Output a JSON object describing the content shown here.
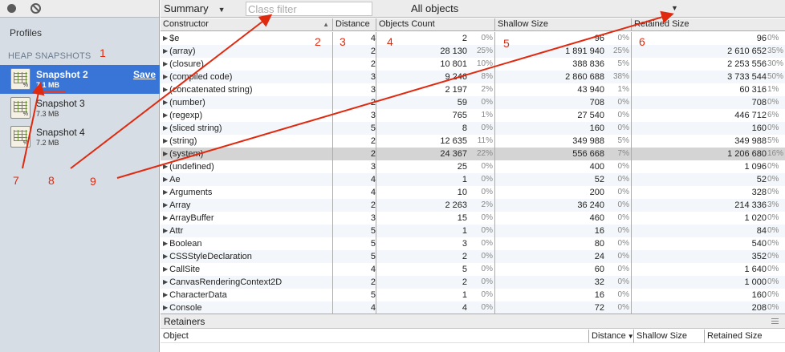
{
  "sidebar": {
    "profiles_title": "Profiles",
    "heap_header": "HEAP SNAPSHOTS",
    "snapshots": [
      {
        "name": "Snapshot 2",
        "size": "7.1 MB",
        "selected": true
      },
      {
        "name": "Snapshot 3",
        "size": "7.3 MB",
        "selected": false
      },
      {
        "name": "Snapshot 4",
        "size": "7.2 MB",
        "selected": false
      }
    ],
    "save_label": "Save"
  },
  "toolbar": {
    "view_select": "Summary",
    "class_filter_placeholder": "Class filter",
    "objects_select": "All objects"
  },
  "columns": {
    "constructor": "Constructor",
    "distance": "Distance",
    "objects_count": "Objects Count",
    "shallow_size": "Shallow Size",
    "retained_size": "Retained Size"
  },
  "rows": [
    {
      "name": "$e",
      "distance": "4",
      "count": "2",
      "count_pct": "0%",
      "shallow": "96",
      "shallow_pct": "0%",
      "retained": "96",
      "retained_pct": "0%"
    },
    {
      "name": "(array)",
      "distance": "2",
      "count": "28 130",
      "count_pct": "25%",
      "shallow": "1 891 940",
      "shallow_pct": "25%",
      "retained": "2 610 652",
      "retained_pct": "35%"
    },
    {
      "name": "(closure)",
      "distance": "2",
      "count": "10 801",
      "count_pct": "10%",
      "shallow": "388 836",
      "shallow_pct": "5%",
      "retained": "2 253 556",
      "retained_pct": "30%"
    },
    {
      "name": "(compiled code)",
      "distance": "3",
      "count": "9 246",
      "count_pct": "8%",
      "shallow": "2 860 688",
      "shallow_pct": "38%",
      "retained": "3 733 544",
      "retained_pct": "50%"
    },
    {
      "name": "(concatenated string)",
      "distance": "3",
      "count": "2 197",
      "count_pct": "2%",
      "shallow": "43 940",
      "shallow_pct": "1%",
      "retained": "60 316",
      "retained_pct": "1%"
    },
    {
      "name": "(number)",
      "distance": "2",
      "count": "59",
      "count_pct": "0%",
      "shallow": "708",
      "shallow_pct": "0%",
      "retained": "708",
      "retained_pct": "0%"
    },
    {
      "name": "(regexp)",
      "distance": "3",
      "count": "765",
      "count_pct": "1%",
      "shallow": "27 540",
      "shallow_pct": "0%",
      "retained": "446 712",
      "retained_pct": "6%"
    },
    {
      "name": "(sliced string)",
      "distance": "5",
      "count": "8",
      "count_pct": "0%",
      "shallow": "160",
      "shallow_pct": "0%",
      "retained": "160",
      "retained_pct": "0%"
    },
    {
      "name": "(string)",
      "distance": "2",
      "count": "12 635",
      "count_pct": "11%",
      "shallow": "349 988",
      "shallow_pct": "5%",
      "retained": "349 988",
      "retained_pct": "5%"
    },
    {
      "name": "(system)",
      "distance": "2",
      "count": "24 367",
      "count_pct": "22%",
      "shallow": "556 668",
      "shallow_pct": "7%",
      "retained": "1 206 680",
      "retained_pct": "16%"
    },
    {
      "name": "(undefined)",
      "distance": "3",
      "count": "25",
      "count_pct": "0%",
      "shallow": "400",
      "shallow_pct": "0%",
      "retained": "1 096",
      "retained_pct": "0%"
    },
    {
      "name": "Ae",
      "distance": "4",
      "count": "1",
      "count_pct": "0%",
      "shallow": "52",
      "shallow_pct": "0%",
      "retained": "52",
      "retained_pct": "0%"
    },
    {
      "name": "Arguments",
      "distance": "4",
      "count": "10",
      "count_pct": "0%",
      "shallow": "200",
      "shallow_pct": "0%",
      "retained": "328",
      "retained_pct": "0%"
    },
    {
      "name": "Array",
      "distance": "2",
      "count": "2 263",
      "count_pct": "2%",
      "shallow": "36 240",
      "shallow_pct": "0%",
      "retained": "214 336",
      "retained_pct": "3%"
    },
    {
      "name": "ArrayBuffer",
      "distance": "3",
      "count": "15",
      "count_pct": "0%",
      "shallow": "460",
      "shallow_pct": "0%",
      "retained": "1 020",
      "retained_pct": "0%"
    },
    {
      "name": "Attr",
      "distance": "5",
      "count": "1",
      "count_pct": "0%",
      "shallow": "16",
      "shallow_pct": "0%",
      "retained": "84",
      "retained_pct": "0%"
    },
    {
      "name": "Boolean",
      "distance": "5",
      "count": "3",
      "count_pct": "0%",
      "shallow": "80",
      "shallow_pct": "0%",
      "retained": "540",
      "retained_pct": "0%"
    },
    {
      "name": "CSSStyleDeclaration",
      "distance": "5",
      "count": "2",
      "count_pct": "0%",
      "shallow": "24",
      "shallow_pct": "0%",
      "retained": "352",
      "retained_pct": "0%"
    },
    {
      "name": "CallSite",
      "distance": "4",
      "count": "5",
      "count_pct": "0%",
      "shallow": "60",
      "shallow_pct": "0%",
      "retained": "1 640",
      "retained_pct": "0%"
    },
    {
      "name": "CanvasRenderingContext2D",
      "distance": "2",
      "count": "2",
      "count_pct": "0%",
      "shallow": "32",
      "shallow_pct": "0%",
      "retained": "1 000",
      "retained_pct": "0%"
    },
    {
      "name": "CharacterData",
      "distance": "5",
      "count": "1",
      "count_pct": "0%",
      "shallow": "16",
      "shallow_pct": "0%",
      "retained": "160",
      "retained_pct": "0%"
    },
    {
      "name": "Console",
      "distance": "4",
      "count": "4",
      "count_pct": "0%",
      "shallow": "72",
      "shallow_pct": "0%",
      "retained": "208",
      "retained_pct": "0%"
    }
  ],
  "selected_row": 9,
  "retainers": {
    "title": "Retainers",
    "columns": {
      "object": "Object",
      "distance": "Distance",
      "shallow_size": "Shallow Size",
      "retained_size": "Retained Size"
    }
  },
  "annotations": {
    "labels": [
      "1",
      "2",
      "3",
      "4",
      "5",
      "6",
      "7",
      "8",
      "9"
    ],
    "color": "#e02a10"
  },
  "colors": {
    "selection_blue": "#3875d7",
    "sidebar_bg": "#d6dde5"
  }
}
